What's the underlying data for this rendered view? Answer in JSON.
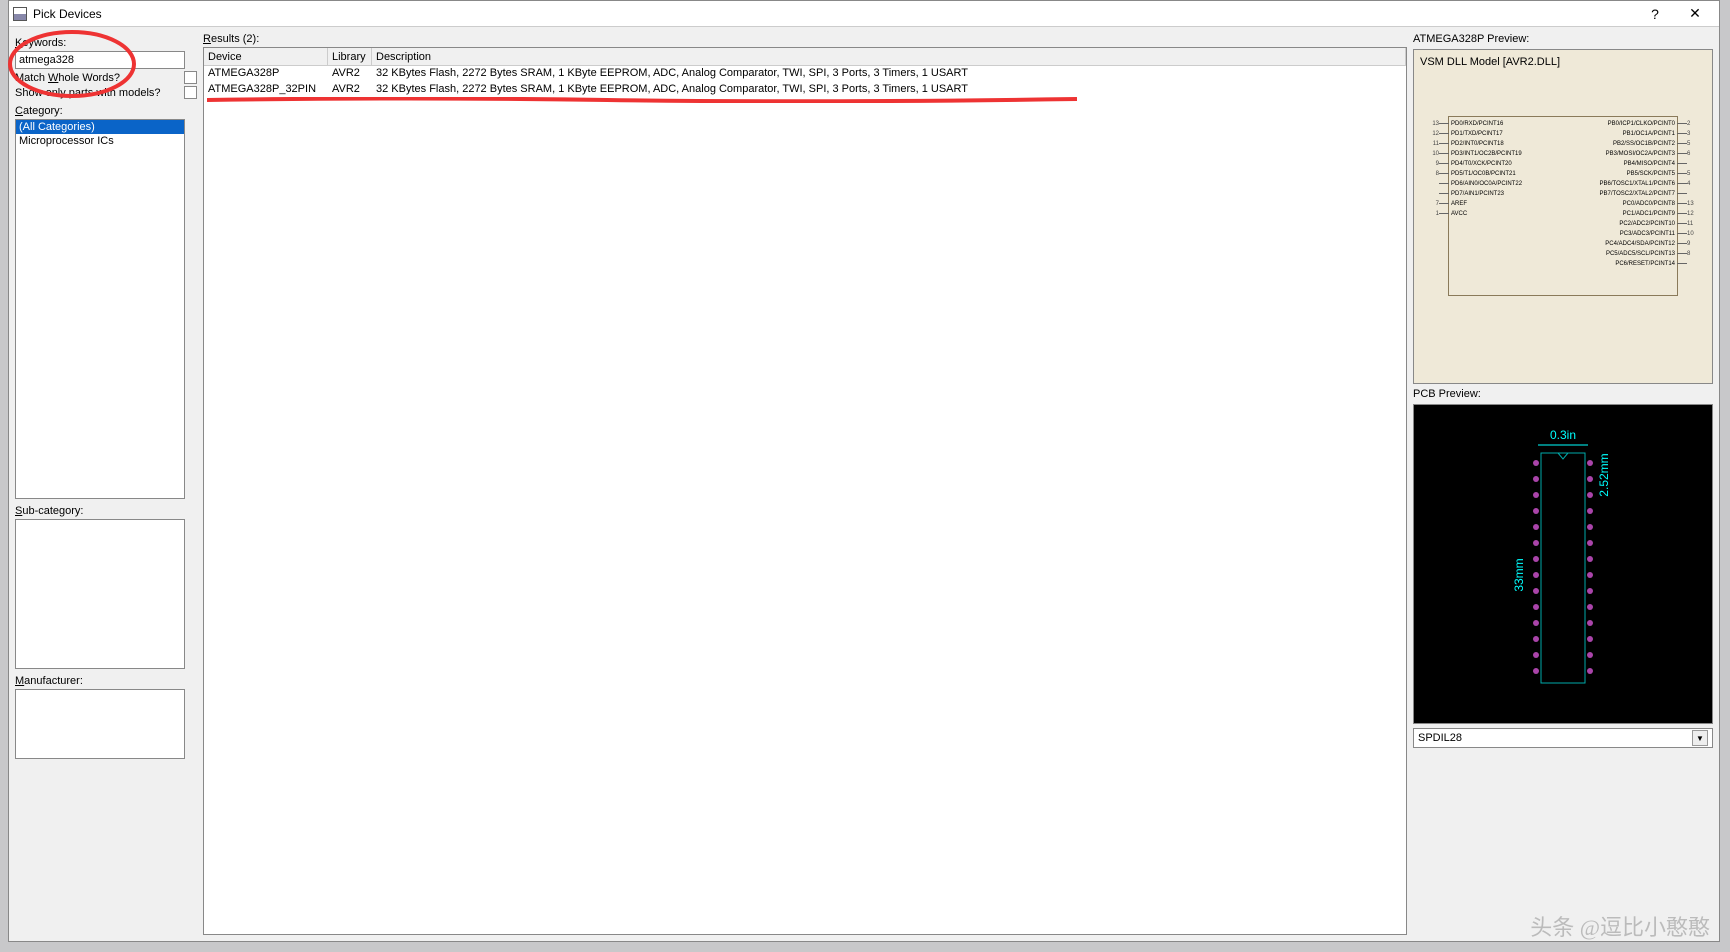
{
  "window": {
    "title": "Pick Devices"
  },
  "left": {
    "keywords_label": "Keywords:",
    "keywords_value": "atmega328",
    "match_whole_label": "Match Whole Words?",
    "show_only_label": "Show only parts with models?",
    "category_label": "Category:",
    "categories": [
      "(All Categories)",
      "Microprocessor ICs"
    ],
    "subcat_label": "Sub-category:",
    "manuf_label": "Manufacturer:"
  },
  "results": {
    "label": "Results (2):",
    "cols": {
      "device": "Device",
      "library": "Library",
      "desc": "Description"
    },
    "rows": [
      {
        "device": "ATMEGA328P",
        "library": "AVR2",
        "desc": "32 KBytes Flash, 2272 Bytes SRAM, 1 KByte EEPROM, ADC, Analog Comparator, TWI, SPI, 3 Ports, 3 Timers, 1 USART"
      },
      {
        "device": "ATMEGA328P_32PIN",
        "library": "AVR2",
        "desc": "32 KBytes Flash, 2272 Bytes SRAM, 1 KByte EEPROM, ADC, Analog Comparator, TWI, SPI, 3 Ports, 3 Timers, 1 USART"
      }
    ]
  },
  "preview": {
    "title_label": "ATMEGA328P Preview:",
    "vsm": "VSM DLL Model [AVR2.DLL]",
    "pcb_label": "PCB Preview:",
    "package": "SPDIL28",
    "dim_w": "0.3in",
    "dim_h": "33mm",
    "dim_p": "2.52mm",
    "pins_left": [
      {
        "n": "13",
        "l": "PD0/RXD/PCINT16"
      },
      {
        "n": "12",
        "l": "PD1/TXD/PCINT17"
      },
      {
        "n": "11",
        "l": "PD2/INT0/PCINT18"
      },
      {
        "n": "10",
        "l": "PD3/INT1/OC2B/PCINT19"
      },
      {
        "n": "9",
        "l": "PD4/T0/XCK/PCINT20"
      },
      {
        "n": "8",
        "l": "PD5/T1/OC0B/PCINT21"
      },
      {
        "n": "",
        "l": "PD6/AIN0/OC0A/PCINT22"
      },
      {
        "n": "",
        "l": "PD7/AIN1/PCINT23"
      },
      {
        "n": "7",
        "l": "AREF"
      },
      {
        "n": "1",
        "l": "AVCC"
      }
    ],
    "pins_right": [
      {
        "n": "2",
        "l": "PB0/ICP1/CLKO/PCINT0"
      },
      {
        "n": "3",
        "l": "PB1/OC1A/PCINT1"
      },
      {
        "n": "5",
        "l": "PB2/SS/OC1B/PCINT2"
      },
      {
        "n": "6",
        "l": "PB3/MOSI/OC2A/PCINT3"
      },
      {
        "n": "",
        "l": "PB4/MISO/PCINT4"
      },
      {
        "n": "5",
        "l": "PB5/SCK/PCINT5"
      },
      {
        "n": "4",
        "l": "PB6/TOSC1/XTAL1/PCINT6"
      },
      {
        "n": "",
        "l": "PB7/TOSC2/XTAL2/PCINT7"
      },
      {
        "n": "13",
        "l": "PC0/ADC0/PCINT8"
      },
      {
        "n": "12",
        "l": "PC1/ADC1/PCINT9"
      },
      {
        "n": "11",
        "l": "PC2/ADC2/PCINT10"
      },
      {
        "n": "10",
        "l": "PC3/ADC3/PCINT11"
      },
      {
        "n": "9",
        "l": "PC4/ADC4/SDA/PCINT12"
      },
      {
        "n": "8",
        "l": "PC5/ADC5/SCL/PCINT13"
      },
      {
        "n": "",
        "l": "PC6/RESET/PCINT14"
      }
    ]
  },
  "watermark": "头条 @逗比小憨憨"
}
